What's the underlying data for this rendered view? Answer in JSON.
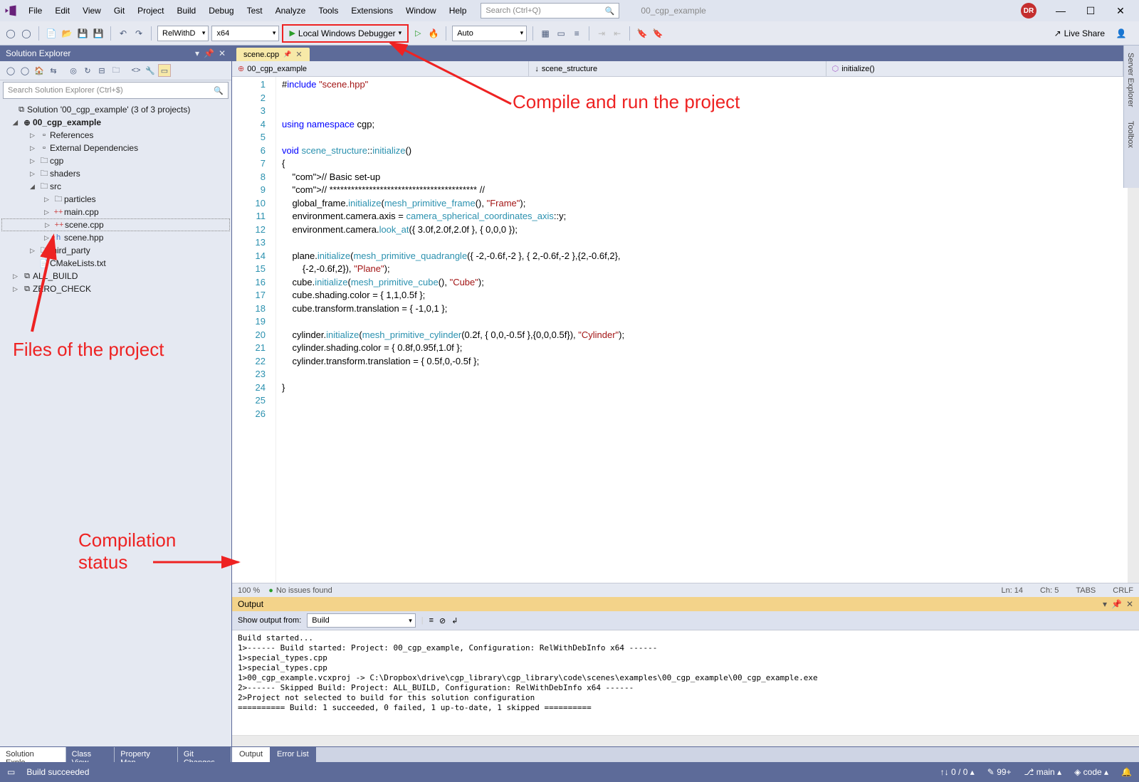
{
  "menu": [
    "File",
    "Edit",
    "View",
    "Git",
    "Project",
    "Build",
    "Debug",
    "Test",
    "Analyze",
    "Tools",
    "Extensions",
    "Window",
    "Help"
  ],
  "search_placeholder": "Search (Ctrl+Q)",
  "titlebar_tab": "00_cgp_example",
  "avatar": "DR",
  "toolbar": {
    "config": "RelWithD",
    "platform": "x64",
    "debugger": "Local Windows Debugger",
    "auto": "Auto",
    "liveshare": "Live Share"
  },
  "solution_explorer": {
    "title": "Solution Explorer",
    "search_placeholder": "Search Solution Explorer (Ctrl+$)",
    "root": "Solution '00_cgp_example' (3 of 3 projects)",
    "project": "00_cgp_example",
    "items": [
      "References",
      "External Dependencies",
      "cgp",
      "shaders"
    ],
    "src": "src",
    "src_items": [
      "particles",
      "main.cpp",
      "scene.cpp",
      "scene.hpp"
    ],
    "third_party": "third_party",
    "cmakelists": "CMakeLists.txt",
    "all_build": "ALL_BUILD",
    "zero_check": "ZERO_CHECK"
  },
  "bottom_tabs_left": [
    "Solution Explo...",
    "Class View",
    "Property Man...",
    "Git Changes"
  ],
  "doc_tab": "scene.cpp",
  "breadcrumb": [
    "00_cgp_example",
    "scene_structure",
    "initialize()"
  ],
  "code_lines": [
    "#include \"scene.hpp\"",
    "",
    "",
    "using namespace cgp;",
    "",
    "void scene_structure::initialize()",
    "{",
    "    // Basic set-up",
    "    // ***************************************** //",
    "    global_frame.initialize(mesh_primitive_frame(), \"Frame\");",
    "    environment.camera.axis = camera_spherical_coordinates_axis::y;",
    "    environment.camera.look_at({ 3.0f,2.0f,2.0f }, { 0,0,0 });",
    "",
    "    plane.initialize(mesh_primitive_quadrangle({ -2,-0.6f,-2 }, { 2,-0.6f,-2 },{2,-0.6f,2},",
    "        {-2,-0.6f,2}), \"Plane\");",
    "    cube.initialize(mesh_primitive_cube(), \"Cube\");",
    "    cube.shading.color = { 1,1,0.5f };",
    "    cube.transform.translation = { -1,0,1 };",
    "",
    "    cylinder.initialize(mesh_primitive_cylinder(0.2f, { 0,0,-0.5f },{0,0,0.5f}), \"Cylinder\");",
    "    cylinder.shading.color = { 0.8f,0.95f,1.0f };",
    "    cylinder.transform.translation = { 0.5f,0,-0.5f };",
    "",
    "}",
    "",
    "",
    ""
  ],
  "editor_status": {
    "zoom": "100 %",
    "issues": "No issues found",
    "ln": "Ln: 14",
    "ch": "Ch: 5",
    "tabs": "TABS",
    "crlf": "CRLF"
  },
  "output": {
    "title": "Output",
    "show_from_label": "Show output from:",
    "show_from": "Build",
    "lines": [
      "Build started...",
      "1>------ Build started: Project: 00_cgp_example, Configuration: RelWithDebInfo x64 ------",
      "1>special_types.cpp",
      "1>special_types.cpp",
      "1>00_cgp_example.vcxproj -> C:\\Dropbox\\drive\\cgp_library\\cgp_library\\code\\scenes\\examples\\00_cgp_example\\00_cgp_example.exe",
      "2>------ Skipped Build: Project: ALL_BUILD, Configuration: RelWithDebInfo x64 ------",
      "2>Project not selected to build for this solution configuration",
      "========== Build: 1 succeeded, 0 failed, 1 up-to-date, 1 skipped =========="
    ]
  },
  "bottom_tabs_editor": [
    "Output",
    "Error List"
  ],
  "statusbar": {
    "build": "Build succeeded",
    "updown": "0 / 0",
    "pencil": "99+",
    "branch": "main",
    "code": "code"
  },
  "right_tabs": [
    "Server Explorer",
    "Toolbox"
  ],
  "annotations": {
    "compile_run": "Compile and run the project",
    "files": "Files of the project",
    "compilation_status": "Compilation\nstatus"
  }
}
